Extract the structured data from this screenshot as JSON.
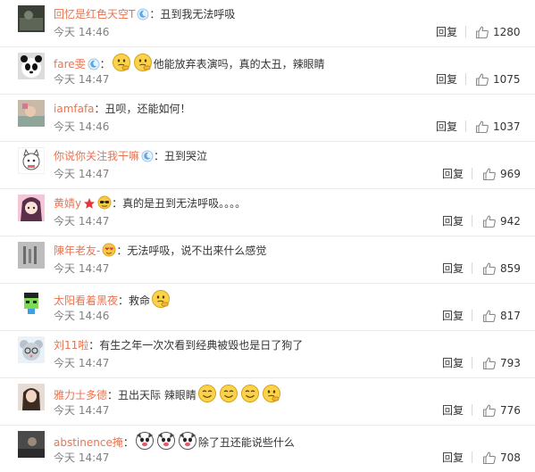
{
  "reply_label": "回复",
  "colors": {
    "username": "#eb7350",
    "text": "#333333",
    "time": "#808080",
    "separator": "#e9e9e9"
  },
  "comments": [
    {
      "user": "回忆是红色天空T",
      "badges": [
        "moon-badge"
      ],
      "text": "：丑到我无法呼吸",
      "emojis": [],
      "time": "今天 14:46",
      "likes": "1280"
    },
    {
      "user": "fare雯",
      "badges": [
        "moon-badge"
      ],
      "text_before": "：",
      "emojis_before": [
        "thinking-emoji",
        "thinking-emoji"
      ],
      "text": "他能放弃表演吗，真的太丑，辣眼睛",
      "emojis": [],
      "time": "今天 14:47",
      "likes": "1075"
    },
    {
      "user": "iamfafa",
      "badges": [],
      "text": "：丑呗，还能如何！",
      "emojis": [],
      "time": "今天 14:46",
      "likes": "1037"
    },
    {
      "user": "你说你关注我干嘛",
      "badges": [
        "moon-badge"
      ],
      "text": "：丑到哭泣",
      "emojis": [],
      "time": "今天 14:47",
      "likes": "969"
    },
    {
      "user": "黄婧y",
      "badges": [
        "star-badge",
        "sunglasses-badge"
      ],
      "text": "：真的是丑到无法呼吸。。。。",
      "emojis": [],
      "time": "今天 14:47",
      "likes": "942"
    },
    {
      "user": "陳年老友-",
      "badges": [
        "heart-eyes-badge"
      ],
      "text": "：无法呼吸，说不出来什么感觉",
      "emojis": [],
      "time": "今天 14:47",
      "likes": "859"
    },
    {
      "user": "太阳看着黑夜",
      "badges": [],
      "text": "：救命",
      "emojis": [
        "thinking-emoji"
      ],
      "time": "今天 14:46",
      "likes": "817"
    },
    {
      "user": "刘11啦",
      "badges": [],
      "text": "：有生之年一次次看到经典被毁也是日了狗了",
      "emojis": [],
      "time": "今天 14:47",
      "likes": "793"
    },
    {
      "user": "雅力士多德",
      "badges": [],
      "text": "：丑出天际 辣眼睛",
      "emojis": [
        "smile-emoji",
        "smile-emoji",
        "smile-emoji",
        "thinking-emoji"
      ],
      "time": "今天 14:47",
      "likes": "776"
    },
    {
      "user": "abstinence掩",
      "badges": [],
      "text_before": "：",
      "emojis_before": [
        "dog-face-emoji",
        "dog-face-emoji",
        "dog-face-emoji"
      ],
      "text": "除了丑还能说些什么",
      "emojis": [],
      "time": "今天 14:47",
      "likes": "708"
    }
  ]
}
